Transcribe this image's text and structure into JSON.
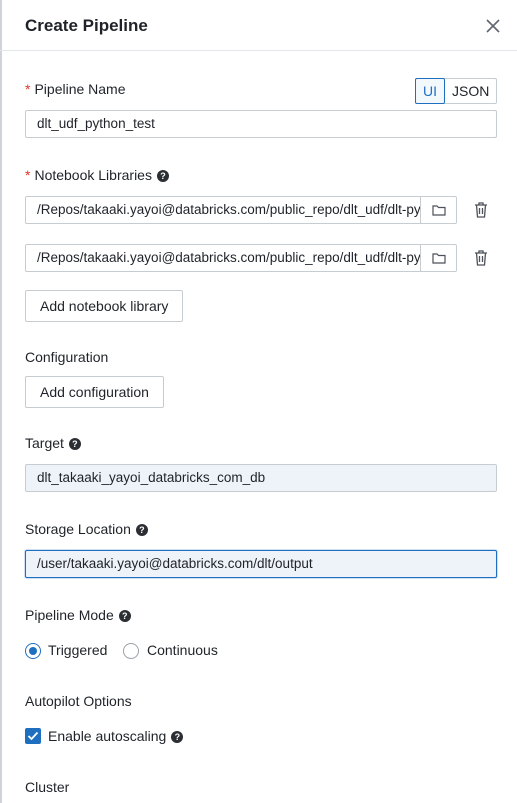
{
  "dialog": {
    "title": "Create Pipeline"
  },
  "pipeline_name": {
    "label": "Pipeline Name",
    "required_mark": "*",
    "value": "dlt_udf_python_test"
  },
  "mode_toggle": {
    "ui_label": "UI",
    "json_label": "JSON",
    "selected": "UI"
  },
  "notebook_libraries": {
    "label": "Notebook Libraries",
    "required_mark": "*",
    "paths": [
      "/Repos/takaaki.yayoi@databricks.com/public_repo/dlt_udf/dlt-python",
      "/Repos/takaaki.yayoi@databricks.com/public_repo/dlt_udf/dlt-python"
    ],
    "add_button": "Add notebook library"
  },
  "configuration": {
    "label": "Configuration",
    "add_button": "Add configuration"
  },
  "target": {
    "label": "Target",
    "value": "dlt_takaaki_yayoi_databricks_com_db"
  },
  "storage_location": {
    "label": "Storage Location",
    "value": "/user/takaaki.yayoi@databricks.com/dlt/output"
  },
  "pipeline_mode": {
    "label": "Pipeline Mode",
    "options": [
      "Triggered",
      "Continuous"
    ],
    "selected": "Triggered"
  },
  "autopilot": {
    "label": "Autopilot Options",
    "autoscaling_label": "Enable autoscaling",
    "autoscaling_checked": true
  },
  "cluster": {
    "label": "Cluster"
  },
  "icons": {
    "help": "help-icon",
    "folder": "folder-icon",
    "trash": "trash-icon",
    "close": "close-icon"
  },
  "colors": {
    "accent": "#1f6fc1",
    "required": "#e0362b",
    "filled_input_bg": "#eef3fa"
  }
}
